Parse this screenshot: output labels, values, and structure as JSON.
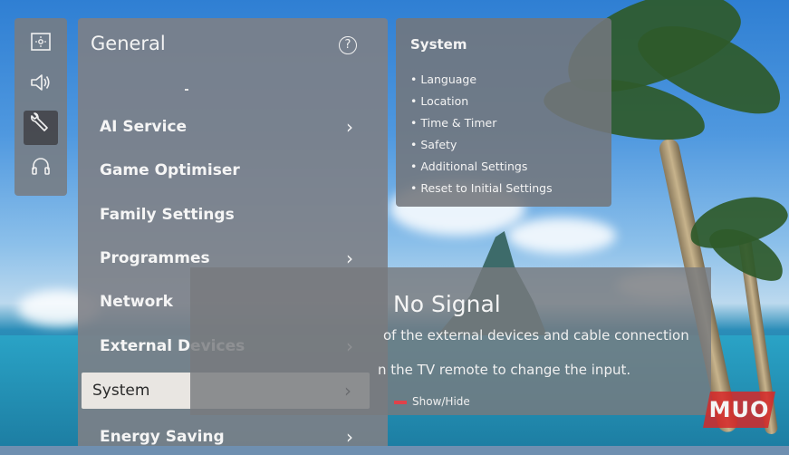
{
  "rail": {
    "items": [
      {
        "icon": "picture-settings-icon"
      },
      {
        "icon": "sound-icon"
      },
      {
        "icon": "wrench-icon",
        "active": true
      },
      {
        "icon": "headset-icon"
      }
    ]
  },
  "panel": {
    "title": "General",
    "help_icon": "?",
    "items": [
      {
        "label": "AI Service",
        "chevron": "›"
      },
      {
        "label": "Game Optimiser",
        "chevron": ""
      },
      {
        "label": "Family Settings",
        "chevron": ""
      },
      {
        "label": "Programmes",
        "chevron": "›"
      },
      {
        "label": "Network",
        "chevron": ""
      },
      {
        "label": "External Devices",
        "chevron": "›"
      },
      {
        "label": "System",
        "chevron": "›",
        "selected": true
      },
      {
        "label": "Energy Saving",
        "chevron": "›"
      }
    ]
  },
  "info": {
    "title": "System",
    "items": [
      "Language",
      "Location",
      "Time & Timer",
      "Safety",
      "Additional Settings",
      "Reset to Initial Settings"
    ]
  },
  "no_signal": {
    "title": "No Signal",
    "line1": "of the external devices and cable connection",
    "line2": "n the TV remote to change the input.",
    "hint": "Show/Hide"
  },
  "watermark": "MUO",
  "colors": {
    "selected_bg": "#e9e6e2",
    "hint_red": "#e0414a",
    "watermark": "#d62828"
  }
}
